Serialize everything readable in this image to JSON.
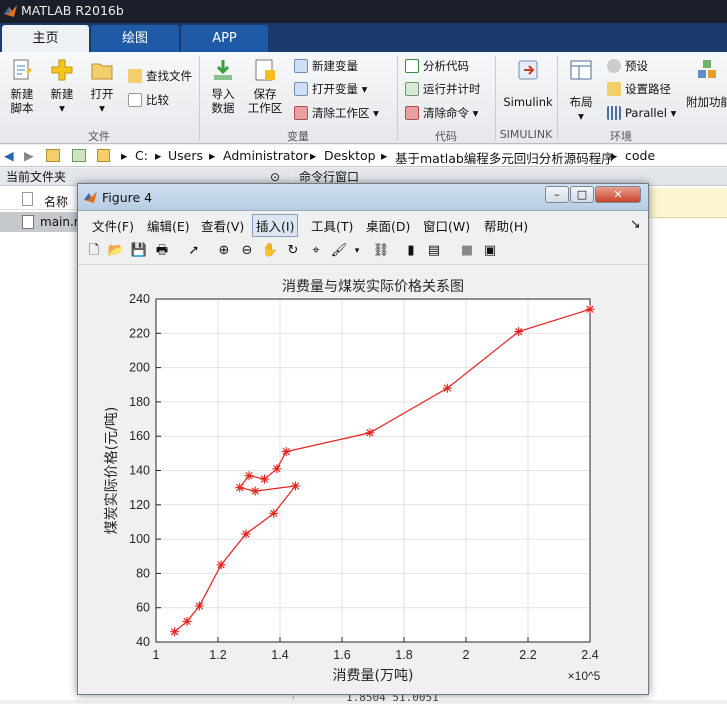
{
  "window": {
    "title": "MATLAB R2016b"
  },
  "tabs": [
    {
      "label": "主页"
    },
    {
      "label": "绘图"
    },
    {
      "label": "APP"
    }
  ],
  "ribbon": {
    "new_script": "新建\n脚本",
    "new": "新建",
    "open": "打开",
    "find_files": "查找文件",
    "compare": "比较",
    "import_data": "导入\n数据",
    "save_workspace": "保存\n工作区",
    "new_variable": "新建变量",
    "open_variable": "打开变量",
    "clear_workspace": "清除工作区",
    "analyze_code": "分析代码",
    "run_and_time": "运行并计时",
    "clear_commands": "清除命令",
    "simulink": "Simulink",
    "layout": "布局",
    "preferences": "预设",
    "set_path": "设置路径",
    "parallel": "Parallel",
    "addons": "附加功能",
    "groups": {
      "file": "文件",
      "variable": "变量",
      "code": "代码",
      "simulink": "SIMULINK",
      "environment": "环境"
    }
  },
  "address": {
    "parts": [
      "C:",
      "Users",
      "Administrator",
      "Desktop",
      "基于matlab编程多元回归分析源码程序",
      "code"
    ]
  },
  "panes": {
    "current_folder": "当前文件夹",
    "command_window": "命令行窗口",
    "name_col": "名称",
    "file": "main.m",
    "bottom_text": "1.8504    51.0051"
  },
  "figure": {
    "title": "Figure 4",
    "menu": [
      "文件(F)",
      "编辑(E)",
      "查看(V)",
      "插入(I)",
      "工具(T)",
      "桌面(D)",
      "窗口(W)",
      "帮助(H)"
    ]
  },
  "chart_data": {
    "type": "line",
    "title": "消费量与煤炭实际价格关系图",
    "xlabel": "消费量(万吨)",
    "ylabel": "煤炭实际价格(元/吨)",
    "x_exponent": "×10^5",
    "xlim": [
      1,
      2.4
    ],
    "ylim": [
      40,
      240
    ],
    "xticks": [
      "1",
      "1.2",
      "1.4",
      "1.6",
      "1.8",
      "2",
      "2.2",
      "2.4"
    ],
    "yticks": [
      "40",
      "60",
      "80",
      "100",
      "120",
      "140",
      "160",
      "180",
      "200",
      "220",
      "240"
    ],
    "grid": true,
    "color": "#e8201b",
    "marker": "*",
    "x": [
      1.06,
      1.1,
      1.14,
      1.21,
      1.29,
      1.38,
      1.45,
      1.32,
      1.27,
      1.3,
      1.35,
      1.39,
      1.42,
      1.69,
      1.94,
      2.17,
      2.4
    ],
    "y": [
      46,
      52,
      61,
      85,
      103,
      115,
      131,
      128,
      130,
      137,
      135,
      141,
      151,
      162,
      188,
      221,
      234
    ]
  }
}
